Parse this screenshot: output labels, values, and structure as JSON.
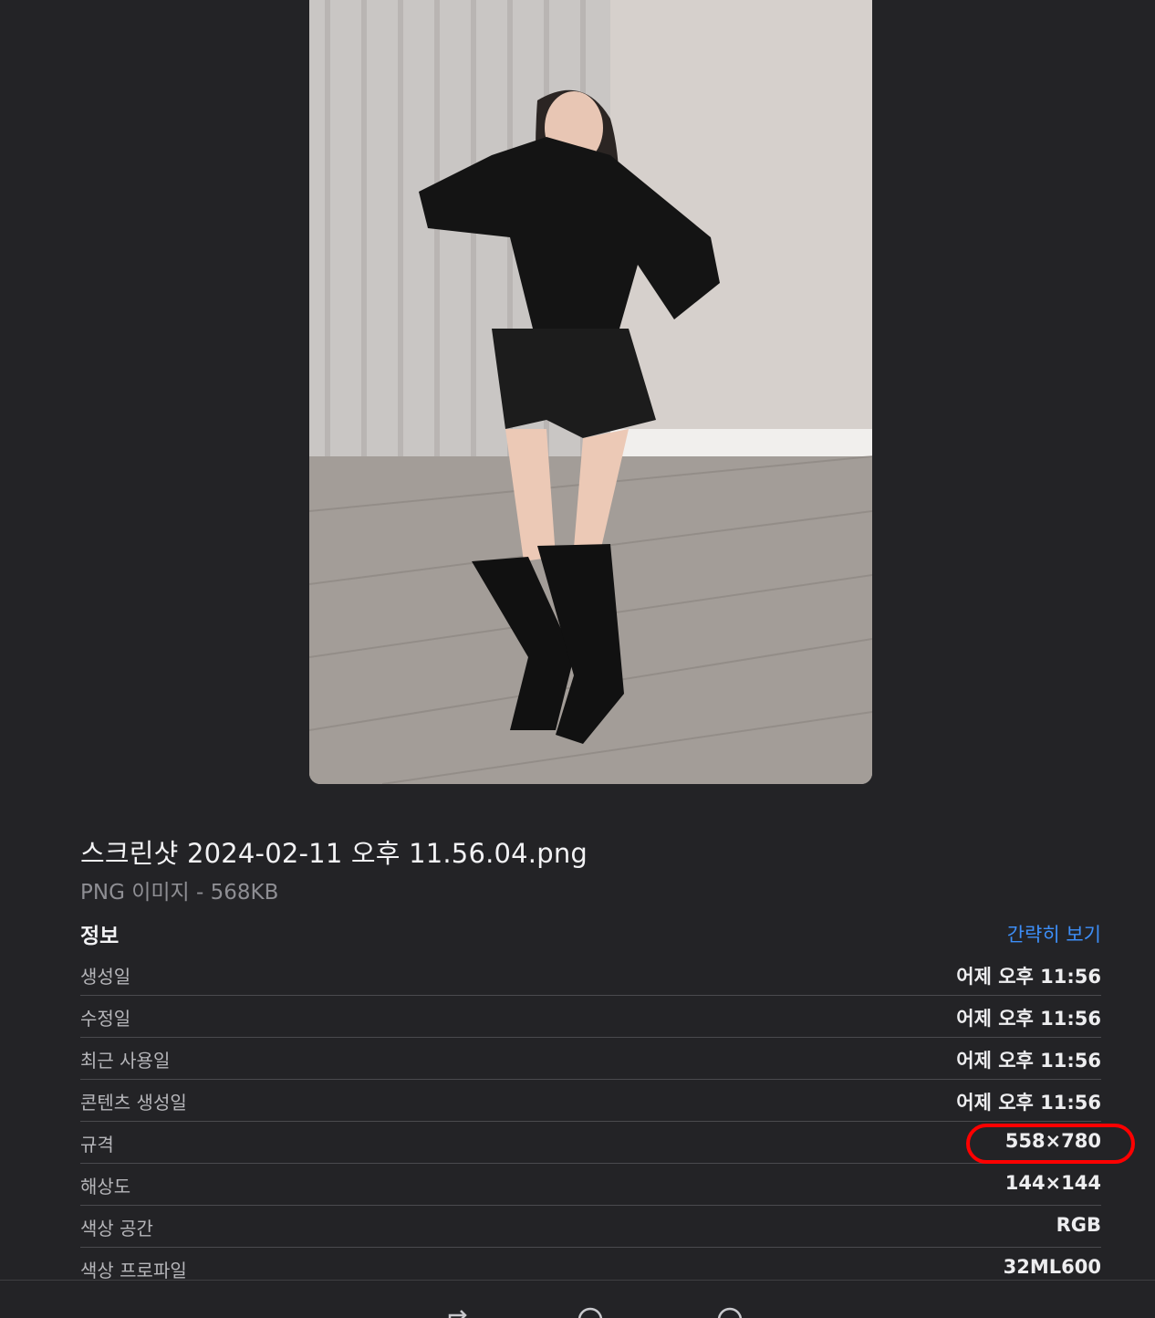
{
  "preview": {
    "icon": "photo-preview"
  },
  "file": {
    "name": "스크린샷 2024-02-11 오후 11.56.04.png",
    "kind_size": "PNG 이미지 - 568KB"
  },
  "info": {
    "title": "정보",
    "toggle_label": "간략히 보기",
    "rows": [
      {
        "label": "생성일",
        "value": "어제 오후 11:56"
      },
      {
        "label": "수정일",
        "value": "어제 오후 11:56"
      },
      {
        "label": "최근 사용일",
        "value": "어제 오후 11:56"
      },
      {
        "label": "콘텐츠 생성일",
        "value": "어제 오후 11:56"
      },
      {
        "label": "규격",
        "value": "558×780"
      },
      {
        "label": "해상도",
        "value": "144×144"
      },
      {
        "label": "색상 공간",
        "value": "RGB"
      },
      {
        "label": "색상 프로파일",
        "value": "32ML600"
      }
    ]
  },
  "colors": {
    "background": "#232326",
    "link": "#3d8ef7",
    "highlight": "#ff0000"
  },
  "toolbar": {
    "icons": [
      "rotate-icon",
      "markup-icon",
      "more-icon"
    ]
  }
}
